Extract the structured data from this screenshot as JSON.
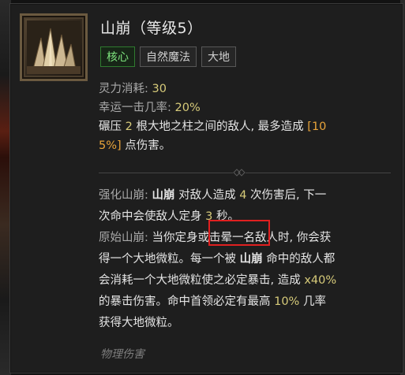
{
  "skill": {
    "title": "山崩（等级5）",
    "tags": [
      "核心",
      "自然魔法",
      "大地"
    ],
    "cost_label": "灵力消耗: ",
    "cost_value": "30",
    "crit_label": "幸运一击几率: ",
    "crit_value": "20%",
    "main_desc": {
      "p1": "碾压 ",
      "n1": "2",
      "p2": " 根大地之柱之间的敌人, 最多造成 ",
      "dmg1": "[10",
      "dmg2": "5%]",
      "p3": " 点伤害。"
    },
    "enhance": {
      "label": "强化山崩: ",
      "name": "山崩",
      "t1": " 对敌人造成 ",
      "hits": "4",
      "t2": " 次伤害后, 下一",
      "t3": "次命中会使敌人定身 ",
      "secs": "3",
      "t4": " 秒。"
    },
    "primal": {
      "label": "原始山崩: ",
      "t1": "当你定身或击晕一名敌人时, 你会获",
      "t2": "得一个大地微粒。每一个被 ",
      "name": "山崩",
      "t3": " 命中的敌人都",
      "t4": "会消耗一个大地微粒使之必定暴击, 造成 ",
      "mult": "x40%",
      "t5": "的暴击伤害。命中首领必定有最高 ",
      "chance": "10%",
      "t6": " 几率",
      "t7": "获得大地微粒。"
    },
    "footer": "物理伤害"
  },
  "colors": {
    "highlight_box": "#e02020",
    "core_tag": "#7ee37e",
    "value_yellow": "#d7cb7a",
    "value_orange": "#e8a43a"
  },
  "icons": {
    "skill_icon": "earth-spikes-icon",
    "divider_mark": "diamond-ornament-icon"
  }
}
